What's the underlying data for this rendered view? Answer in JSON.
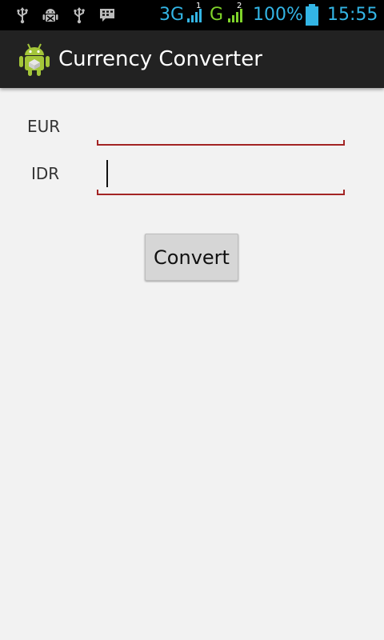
{
  "status_bar": {
    "network_1": "3G",
    "network_1_sim": "1",
    "network_2": "G",
    "network_2_sim": "2",
    "battery": "100%",
    "time": "15:55",
    "colors": {
      "network_1": "#33b5e5",
      "network_2": "#7fd32a",
      "battery": "#33b5e5",
      "time": "#33b5e5"
    },
    "left_icons": [
      "usb-icon",
      "android-debug-icon",
      "usb-icon",
      "bbm-chat-icon"
    ]
  },
  "action_bar": {
    "title": "Currency Converter",
    "icon": "android-robot-icon"
  },
  "form": {
    "eur": {
      "label": "EUR",
      "value": ""
    },
    "idr": {
      "label": "IDR",
      "value": ""
    },
    "convert_label": "Convert"
  }
}
